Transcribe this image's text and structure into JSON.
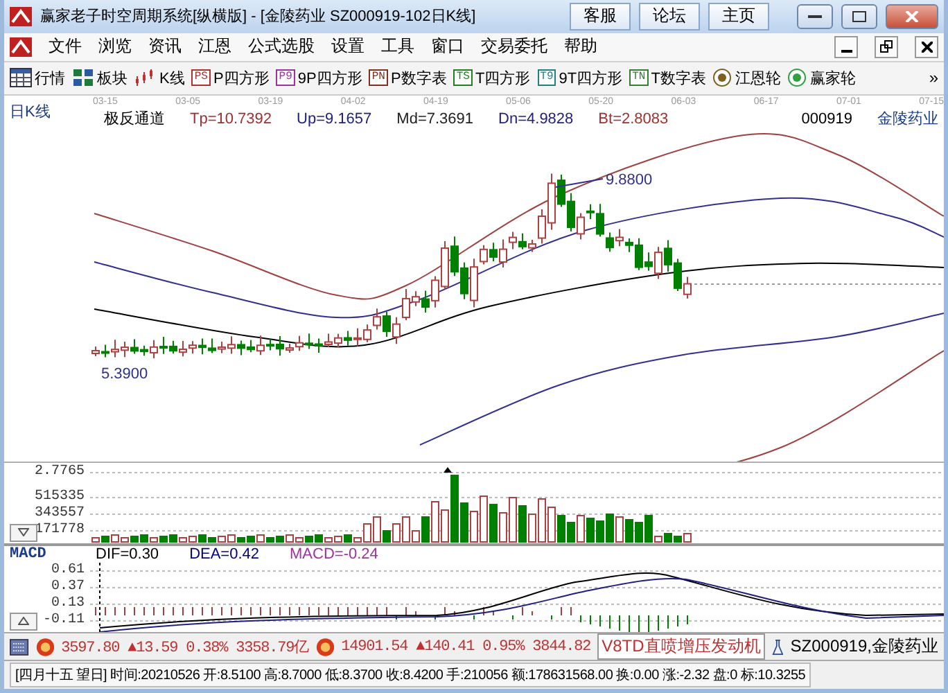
{
  "window": {
    "title": "赢家老子时空周期系统[纵横版] - [金陵药业  SZ000919-102日K线]",
    "title_buttons": [
      "客服",
      "论坛",
      "主页"
    ]
  },
  "menu": [
    "文件",
    "浏览",
    "资讯",
    "江恩",
    "公式选股",
    "设置",
    "工具",
    "窗口",
    "交易委托",
    "帮助"
  ],
  "toolbar": [
    {
      "kind": "grid",
      "label": "行情"
    },
    {
      "kind": "blocks",
      "label": "板块"
    },
    {
      "kind": "candles",
      "label": "K线"
    },
    {
      "kind": "tag",
      "tag": "PS",
      "color": "#b03030",
      "label": "P四方形"
    },
    {
      "kind": "tag",
      "tag": "P9",
      "color": "#a030a0",
      "label": "9P四方形"
    },
    {
      "kind": "tag",
      "tag": "PN",
      "color": "#803020",
      "label": "P数字表"
    },
    {
      "kind": "tag",
      "tag": "TS",
      "color": "#208020",
      "label": "T四方形"
    },
    {
      "kind": "tag",
      "tag": "T9",
      "color": "#208080",
      "label": "9T四方形"
    },
    {
      "kind": "tag",
      "tag": "TN",
      "color": "#308030",
      "label": "T数字表"
    },
    {
      "kind": "wheel",
      "color": "#806020",
      "label": "江恩轮"
    },
    {
      "kind": "wheel",
      "color": "#30a040",
      "label": "赢家轮"
    }
  ],
  "toolbar_overflow": "»",
  "date_axis": [
    "03-15",
    "03-05",
    "03-19",
    "04-02",
    "04-19",
    "05-06",
    "05-20",
    "06-03",
    "06-17",
    "07-01",
    "07-15"
  ],
  "chart": {
    "period": "日K线",
    "indicator": "极反通道",
    "params": [
      {
        "text": "Tp=10.7392",
        "color": "#a03030"
      },
      {
        "text": "Up=9.1657",
        "color": "#202080"
      },
      {
        "text": "Md=7.3691",
        "color": "#202020"
      },
      {
        "text": "Dn=4.9828",
        "color": "#202080"
      },
      {
        "text": "Bt=2.8083",
        "color": "#a03030"
      }
    ],
    "code": "000919",
    "name": "金陵药业",
    "high_label": "9.8800",
    "low_label": "5.3900"
  },
  "volume": {
    "labels": [
      "2.7765",
      "515335",
      "343557",
      "171778"
    ]
  },
  "macd": {
    "title": "MACD",
    "params": [
      {
        "text": "DIF=0.30",
        "color": "#000000"
      },
      {
        "text": "DEA=0.42",
        "color": "#000080"
      },
      {
        "text": "MACD=-0.24",
        "color": "#a030a0"
      }
    ],
    "ticks": [
      "0.61",
      "0.37",
      "0.13",
      "-0.11"
    ]
  },
  "indices": [
    {
      "text": "3597.80 ▲13.59 0.38% 3358.79亿"
    },
    {
      "text": "14901.54 ▲140.41 0.95% 3844.82"
    }
  ],
  "ticker": "V8TD直喷增压发动机",
  "stock_label": "SZ000919,金陵药业",
  "info_line": "[四月十五  望日] 时间:20210526 开:8.5100 高:8.7000 低:8.3700 收:8.4200 手:210056 额:178631568.00 换:0.00 涨:-2.32 盘:0 标:10.3255"
}
